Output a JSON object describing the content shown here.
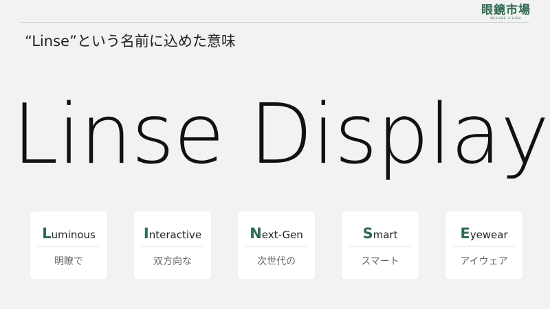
{
  "logo": {
    "text": "眼鏡市場",
    "sub": "MEGANE ICHIBA"
  },
  "title": "“Linse”という名前に込めた意味",
  "hero": {
    "word1": "Linse",
    "word2": "Display"
  },
  "cards": [
    {
      "initial": "L",
      "rest": "uminous",
      "jp": "明瞭で"
    },
    {
      "initial": "I",
      "rest": "nteractive",
      "jp": "双方向な"
    },
    {
      "initial": "N",
      "rest": "ext-Gen",
      "jp": "次世代の"
    },
    {
      "initial": "S",
      "rest": "mart",
      "jp": "スマート"
    },
    {
      "initial": "E",
      "rest": "yewear",
      "jp": "アイウェア"
    }
  ],
  "colors": {
    "accent": "#2f6b4f",
    "background": "#f2f2f2",
    "card": "#ffffff"
  }
}
